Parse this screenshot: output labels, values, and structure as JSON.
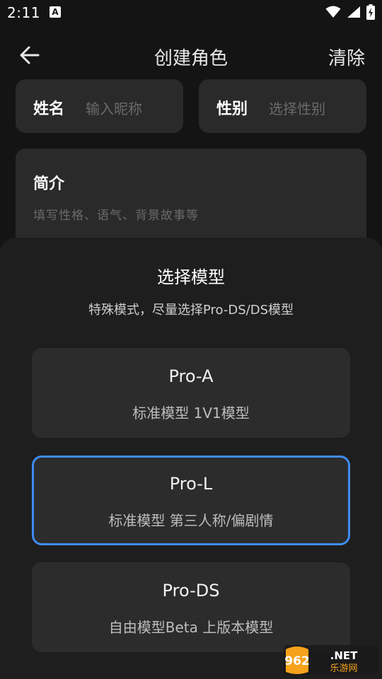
{
  "status_bar": {
    "time": "2:11",
    "notification_letter": "A"
  },
  "header": {
    "title": "创建角色",
    "clear_label": "清除"
  },
  "form": {
    "name_label": "姓名",
    "name_placeholder": "输入昵称",
    "gender_label": "性别",
    "gender_placeholder": "选择性别",
    "intro_label": "简介",
    "intro_placeholder": "填写性格、语气、背景故事等"
  },
  "sheet": {
    "title": "选择模型",
    "subtitle": "特殊模式，尽量选择Pro-DS/DS模型",
    "models": [
      {
        "name": "Pro-A",
        "desc": "标准模型 1V1模型",
        "selected": false
      },
      {
        "name": "Pro-L",
        "desc": "标准模型 第三人称/偏剧情",
        "selected": true
      },
      {
        "name": "Pro-DS",
        "desc": "自由模型Beta 上版本模型",
        "selected": false
      }
    ]
  },
  "watermark": {
    "line1": "962.NET",
    "line2": "乐游网"
  },
  "colors": {
    "background": "#141414",
    "field": "#2a2a2a",
    "sheet": "#1e1e1e",
    "card": "#2c2c2c",
    "accent": "#3f8cf4"
  }
}
